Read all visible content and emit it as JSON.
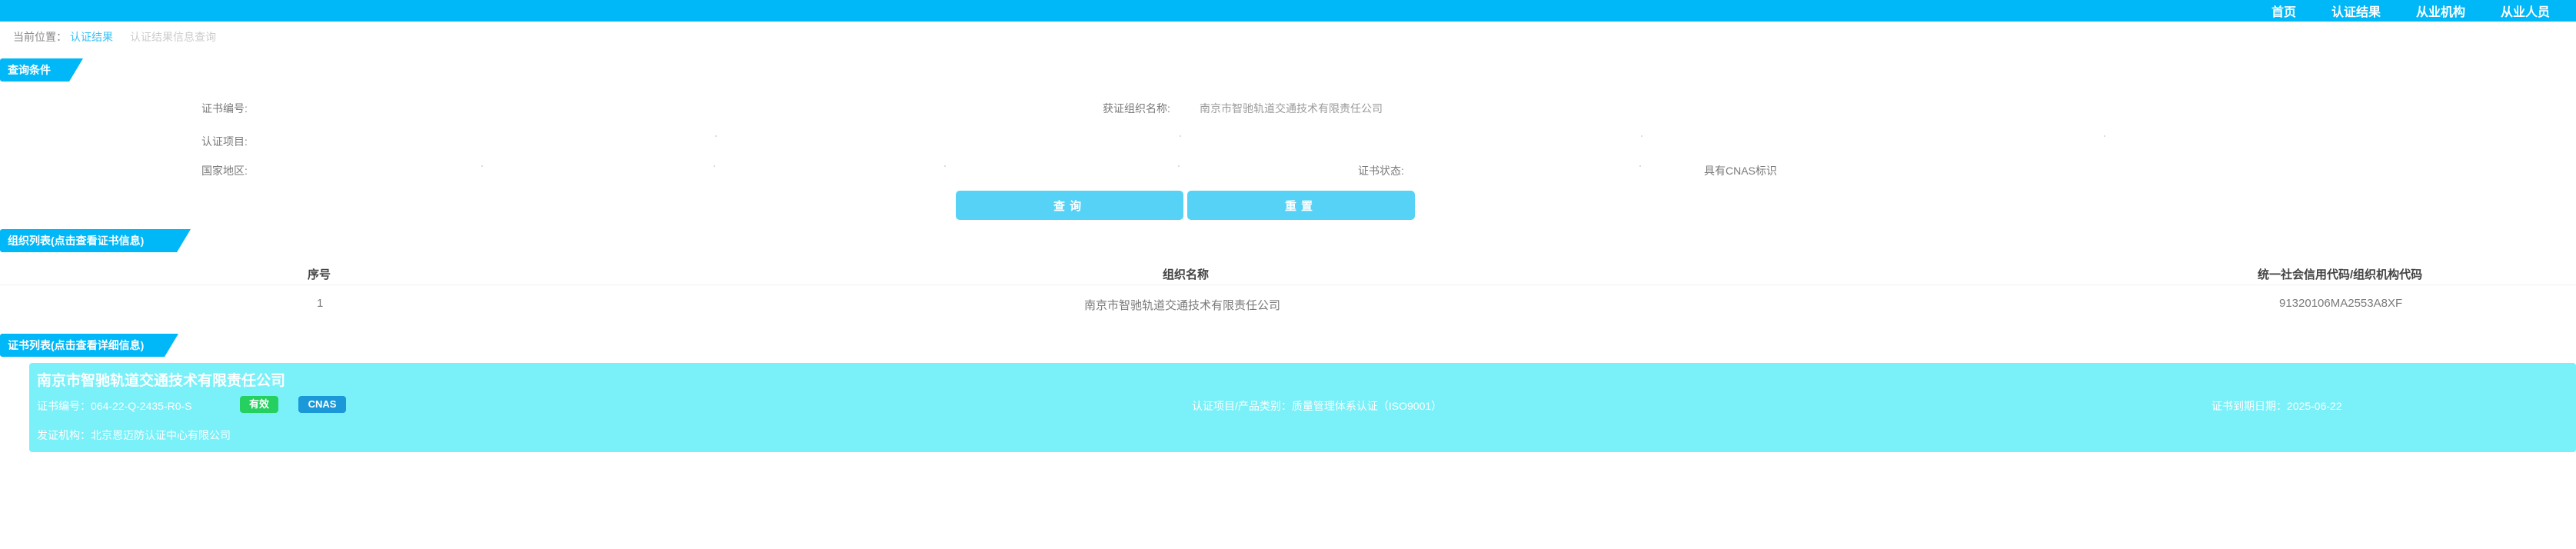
{
  "nav": {
    "items": [
      "首页",
      "认证结果",
      "从业机构",
      "从业人员"
    ]
  },
  "breadcrumb": {
    "prefix": "当前位置：",
    "current": "认证结果",
    "sub": "认证结果信息查询"
  },
  "query_section": {
    "title": "查询条件",
    "cert_no_label": "证书编号:",
    "org_name_label": "获证组织名称:",
    "org_name_value": "南京市智驰轨道交通技术有限责任公司",
    "project_label": "认证项目:",
    "region_label": "国家地区:",
    "status_label": "证书状态:",
    "cnas_label": "具有CNAS标识",
    "search_button": "查询",
    "reset_button": "重置"
  },
  "org_list": {
    "title": "组织列表(点击查看证书信息)",
    "headers": [
      "序号",
      "组织名称",
      "统一社会信用代码/组织机构代码"
    ],
    "rows": [
      {
        "index": "1",
        "name": "南京市智驰轨道交通技术有限责任公司",
        "code": "91320106MA2553A8XF"
      }
    ]
  },
  "cert_list": {
    "title": "证书列表(点击查看详细信息)",
    "items": [
      {
        "org_name": "南京市智驰轨道交通技术有限责任公司",
        "cert_no": "证书编号：064-22-Q-2435-R0-S",
        "status_badge": "有效",
        "cnas_badge": "CNAS",
        "project": "认证项目/产品类别：质量管理体系认证（ISO9001）",
        "expiry": "证书到期日期：2025-06-22",
        "issuer": "发证机构：北京恩迈防认证中心有限公司"
      }
    ]
  },
  "colors": {
    "primary": "#00b7f7",
    "button": "#55d2f6",
    "card": "#7af0f8",
    "valid": "#26d060",
    "cnas": "#1a98d8"
  }
}
